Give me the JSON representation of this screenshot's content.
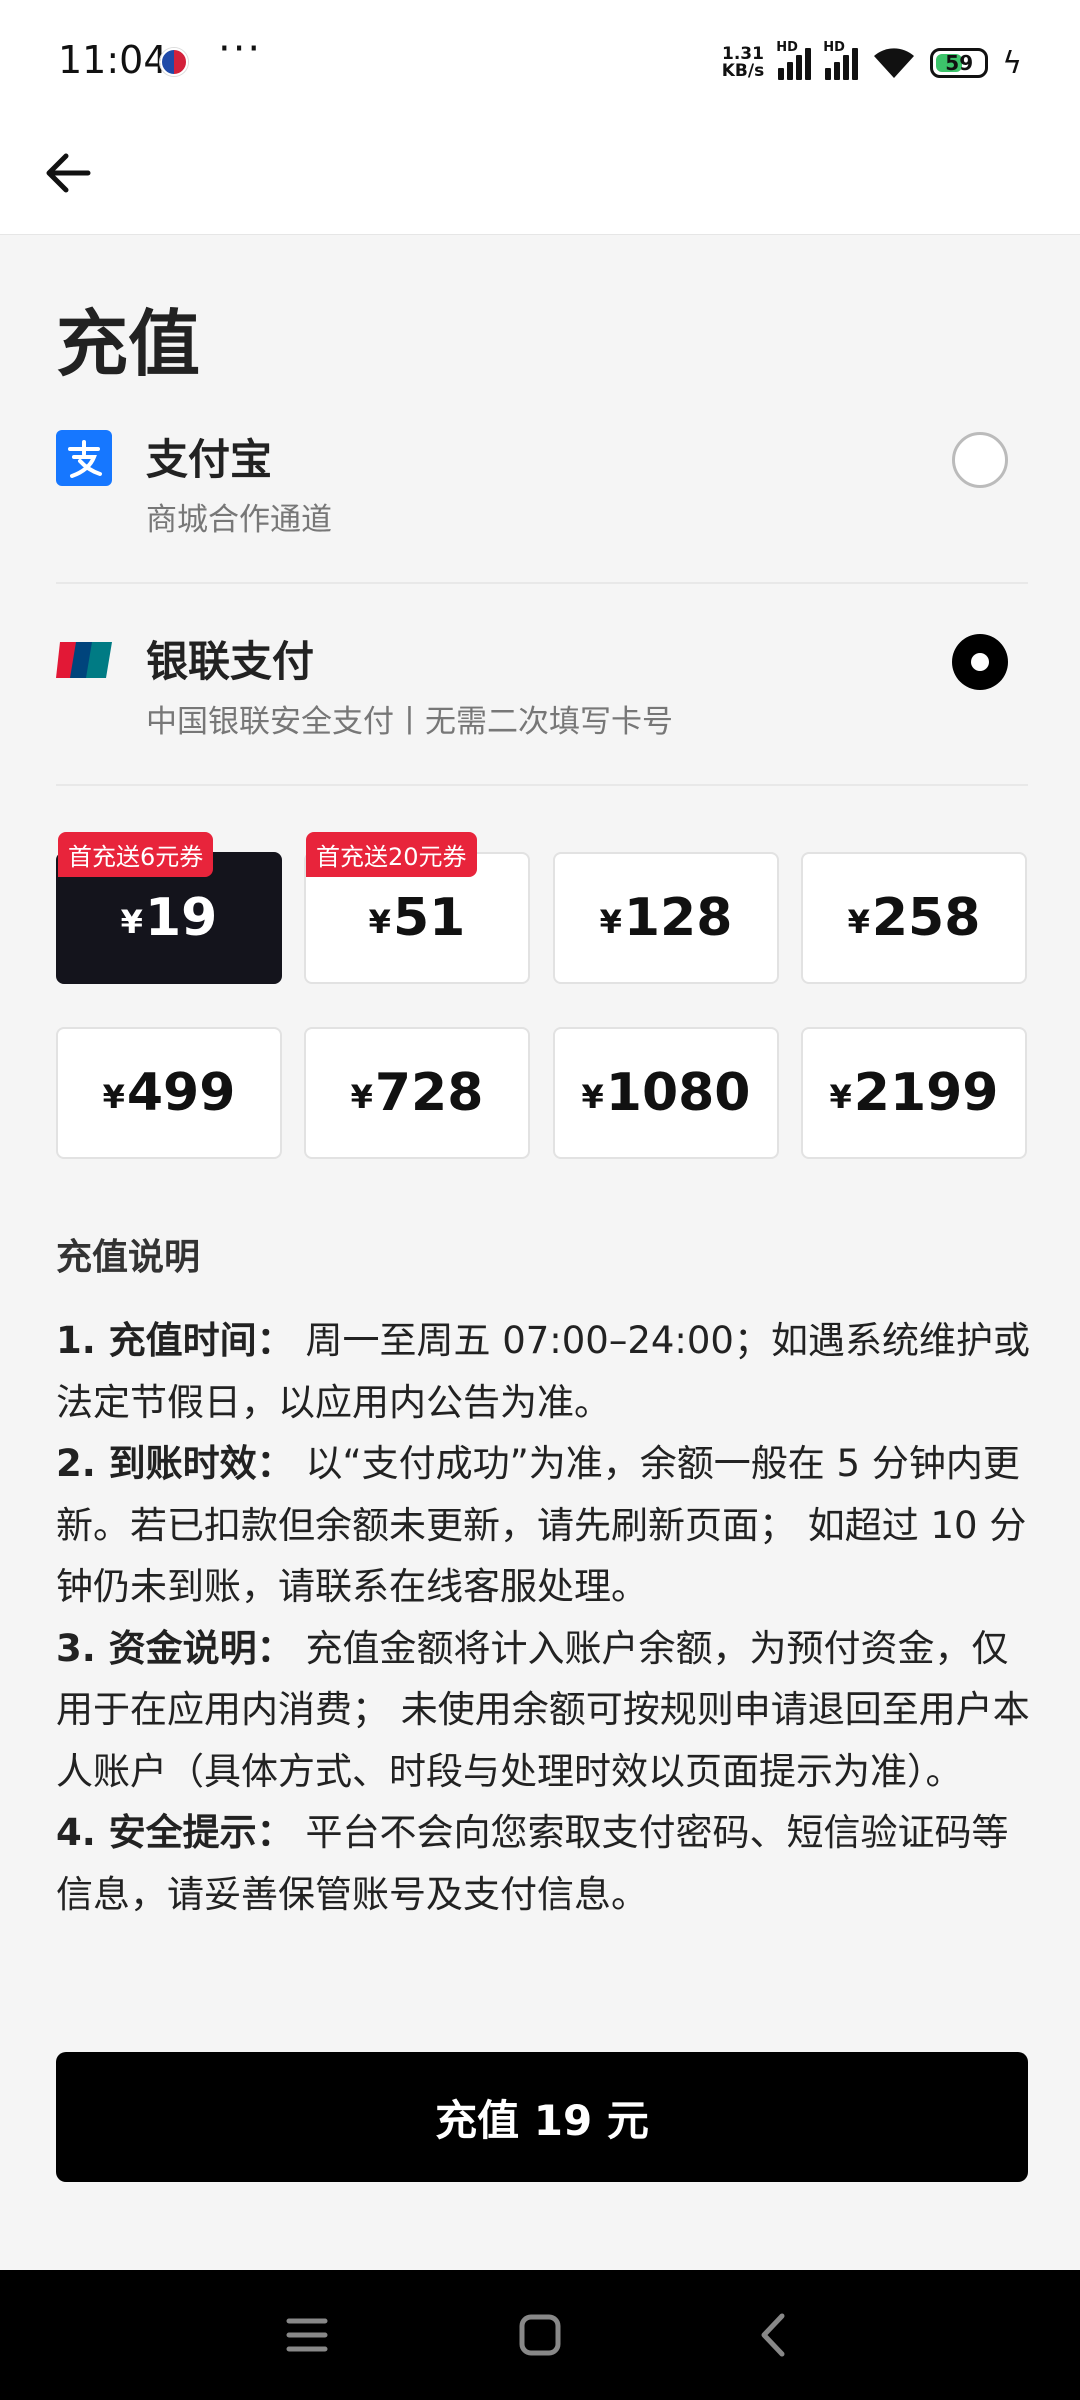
{
  "status_bar": {
    "time": "11:04",
    "more": "···",
    "net_speed_value": "1.31",
    "net_speed_unit": "KB/s",
    "hd_label": "HD",
    "battery": "59"
  },
  "header": {
    "back_icon": "arrow-left-icon"
  },
  "page": {
    "title": "充值"
  },
  "payment_methods": [
    {
      "name": "支付宝",
      "subtitle": "商城合作通道",
      "icon": "alipay-icon",
      "selected": false
    },
    {
      "name": "银联支付",
      "subtitle": "中国银联安全支付丨无需二次填写卡号",
      "icon": "unionpay-icon",
      "selected": true
    }
  ],
  "amounts": [
    {
      "currency": "¥",
      "value": "19",
      "promo": "首充送6元券",
      "selected": true
    },
    {
      "currency": "¥",
      "value": "51",
      "promo": "首充送20元券",
      "selected": false
    },
    {
      "currency": "¥",
      "value": "128",
      "promo": "",
      "selected": false
    },
    {
      "currency": "¥",
      "value": "258",
      "promo": "",
      "selected": false
    },
    {
      "currency": "¥",
      "value": "499",
      "promo": "",
      "selected": false
    },
    {
      "currency": "¥",
      "value": "728",
      "promo": "",
      "selected": false
    },
    {
      "currency": "¥",
      "value": "1080",
      "promo": "",
      "selected": false
    },
    {
      "currency": "¥",
      "value": "2199",
      "promo": "",
      "selected": false
    }
  ],
  "description": {
    "title": "充值说明",
    "items": [
      {
        "label": "1. 充值时间：",
        "text": " 周一至周五 07:00–24:00；如遇系统维护或法定节假日，以应用内公告为准。"
      },
      {
        "label": "2. 到账时效：",
        "text": " 以“支付成功”为准，余额一般在 5 分钟内更新。若已扣款但余额未更新，请先刷新页面； 如超过 10 分钟仍未到账，请联系在线客服处理。"
      },
      {
        "label": "3. 资金说明：",
        "text": " 充值金额将计入账户余额，为预付资金，仅用于在应用内消费； 未使用余额可按规则申请退回至用户本人账户（具体方式、时段与处理时效以页面提示为准）。"
      },
      {
        "label": "4. 安全提示：",
        "text": " 平台不会向您索取支付密码、短信验证码等信息，请妥善保管账号及支付信息。"
      }
    ]
  },
  "pay_button": {
    "label": "充值 19 元"
  },
  "nav_bar": {
    "menu_icon": "menu-icon",
    "home_icon": "home-icon",
    "back_icon": "back-chevron-icon"
  }
}
